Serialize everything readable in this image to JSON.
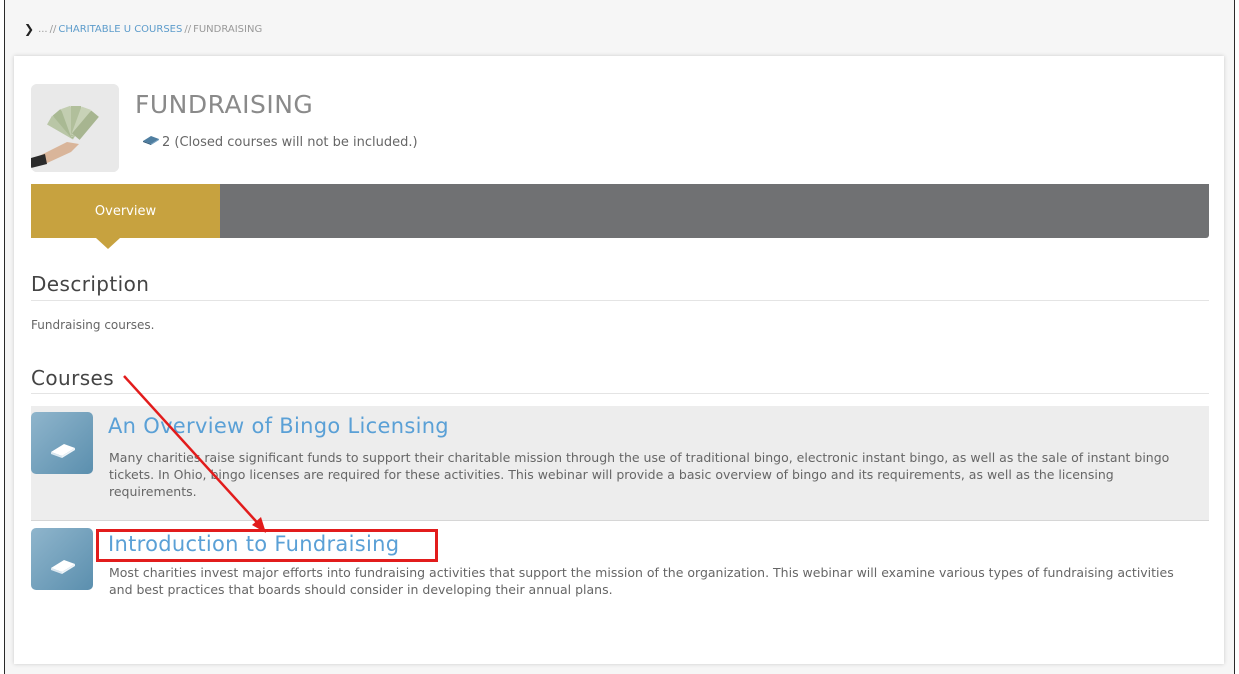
{
  "breadcrumb": {
    "chevron": "❯",
    "ellipsis": "...",
    "sep1": "//",
    "link": "CHARITABLE U COURSES",
    "sep2": "//",
    "current": "FUNDRAISING"
  },
  "category": {
    "title": "FUNDRAISING",
    "course_count": "2 (Closed courses will not be included.)"
  },
  "tabs": [
    {
      "label": "Overview",
      "active": true
    }
  ],
  "description": {
    "heading": "Description",
    "text": "Fundraising courses."
  },
  "courses": {
    "heading": "Courses",
    "items": [
      {
        "title": "An Overview of Bingo Licensing",
        "description": "Many charities raise significant funds to support their charitable mission through the use of traditional bingo, electronic instant bingo, as well as the sale of instant bingo tickets. In Ohio, bingo licenses are required for these activities. This webinar will provide a basic overview of bingo and its requirements, as well as the licensing requirements."
      },
      {
        "title": "Introduction to Fundraising",
        "description": "Most charities invest major efforts into fundraising activities that support the mission of the organization. This webinar will examine various types of fundraising activities and best practices that boards should consider in developing their annual plans."
      }
    ]
  },
  "colors": {
    "accent_gold": "#c7a23f",
    "tabbar_gray": "#707173",
    "link_blue": "#5aa0d6",
    "annotation_red": "#e21c1c"
  }
}
